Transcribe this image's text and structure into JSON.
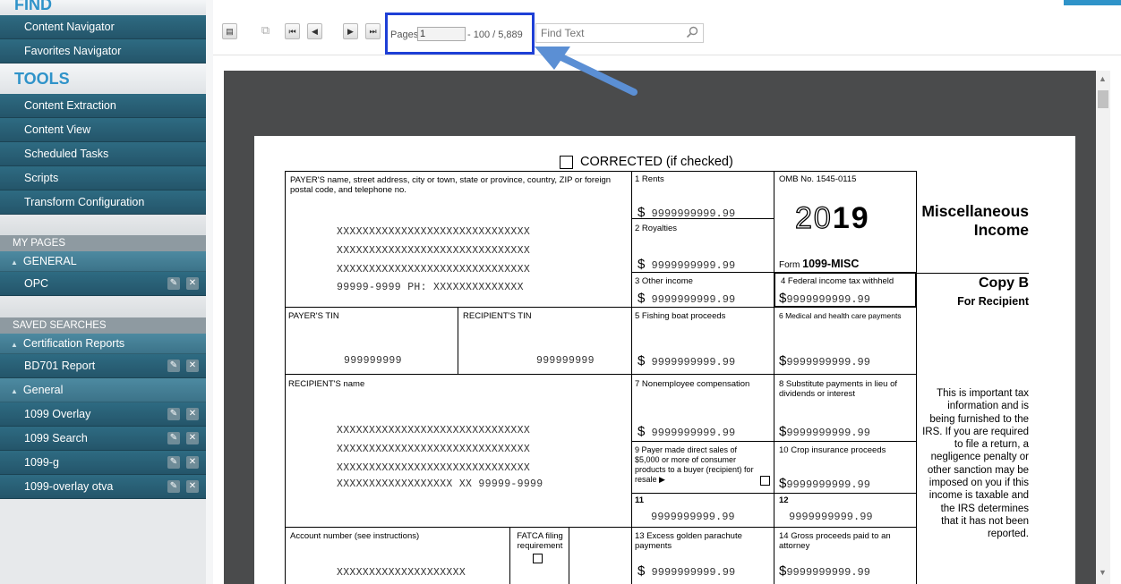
{
  "sidebar": {
    "find_title": "FIND",
    "find_items": [
      "Content Navigator",
      "Favorites Navigator"
    ],
    "tools_title": "TOOLS",
    "tools_items": [
      "Content Extraction",
      "Content View",
      "Scheduled Tasks",
      "Scripts",
      "Transform Configuration"
    ],
    "my_pages_title": "MY PAGES",
    "my_pages_group": "GENERAL",
    "my_pages_items": [
      "OPC"
    ],
    "saved_searches_title": "SAVED SEARCHES",
    "saved_group_1": "Certification Reports",
    "saved_group_1_items": [
      "BD701 Report"
    ],
    "saved_group_2": "General",
    "saved_group_2_items": [
      "1099 Overlay",
      "1099 Search",
      "1099-g",
      "1099-overlay otva"
    ]
  },
  "toolbar": {
    "pages_label": "Pages",
    "pages_value": "1",
    "pages_total": "- 100 / 5,889",
    "find_placeholder": "Find Text"
  },
  "form": {
    "corrected": "CORRECTED (if checked)",
    "payer_label": "PAYER'S name, street address, city or town, state or province, country, ZIP or foreign postal code, and telephone no.",
    "payer_lines": [
      "XXXXXXXXXXXXXXXXXXXXXXXXXXXXXX",
      "XXXXXXXXXXXXXXXXXXXXXXXXXXXXXX",
      "XXXXXXXXXXXXXXXXXXXXXXXXXXXXXX",
      "99999-9999  PH: XXXXXXXXXXXXXX"
    ],
    "box1": "1 Rents",
    "box2": "2 Royalties",
    "box3": "3 Other income",
    "box4": "4 Federal income tax withheld",
    "box5": "5 Fishing boat proceeds",
    "box6": "6 Medical and health care payments",
    "box7": "7 Nonemployee compensation",
    "box8": "8 Substitute payments in lieu of dividends or interest",
    "box9": "9 Payer made direct sales of $5,000 or more of consumer products to a buyer (recipient) for resale ▶",
    "box10": "10 Crop insurance proceeds",
    "box11": "11",
    "box12": "12",
    "box13": "13 Excess golden parachute payments",
    "box14": "14 Gross proceeds paid to an attorney",
    "omb": "OMB No. 1545-0115",
    "year_left": "20",
    "year_right": "19",
    "form_prefix": "Form",
    "form_name": "1099-MISC",
    "title_line1": "Miscellaneous",
    "title_line2": "Income",
    "copy_title": "Copy B",
    "copy_sub": "For Recipient",
    "payer_tin_label": "PAYER'S TIN",
    "recipient_tin_label": "RECIPIENT'S TIN",
    "payer_tin": "999999999",
    "recipient_tin": "999999999",
    "recipient_name_label": "RECIPIENT'S name",
    "recipient_lines": [
      "XXXXXXXXXXXXXXXXXXXXXXXXXXXXXX",
      "XXXXXXXXXXXXXXXXXXXXXXXXXXXXXX",
      "XXXXXXXXXXXXXXXXXXXXXXXXXXXXXX",
      "XXXXXXXXXXXXXXXXXX  XX 99999-9999"
    ],
    "account_label": "Account number (see instructions)",
    "account_value": "XXXXXXXXXXXXXXXXXXXX",
    "fatca_label": "FATCA filing requirement",
    "amount": "9999999999.99",
    "notice": "This is important tax information and is being furnished to the IRS. If you are required to file a return, a negligence penalty or other sanction may be imposed on you if this income is taxable and the IRS determines that it has not been reported."
  }
}
